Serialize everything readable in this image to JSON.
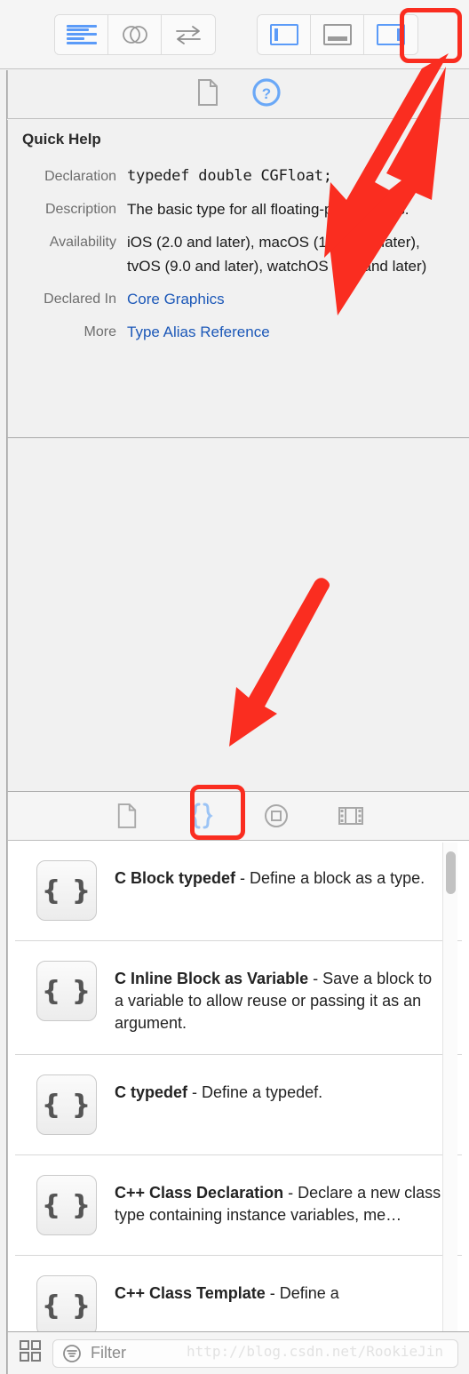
{
  "toolbar": {
    "editor_group": [
      {
        "name": "standard-editor",
        "icon": "lines-icon",
        "active": true
      },
      {
        "name": "assistant-editor",
        "icon": "venn-circles-icon",
        "active": false
      },
      {
        "name": "version-editor",
        "icon": "arrows-swap-icon",
        "active": false
      }
    ],
    "panel_group": [
      {
        "name": "navigator-toggle",
        "icon": "left-pane-icon",
        "active": true
      },
      {
        "name": "debug-area-toggle",
        "icon": "bottom-pane-icon",
        "active": false
      },
      {
        "name": "utilities-toggle",
        "icon": "right-pane-icon",
        "active": true,
        "highlighted": true
      }
    ]
  },
  "inspector_tabs": [
    {
      "name": "file-inspector",
      "icon": "document-icon",
      "selected": false
    },
    {
      "name": "quick-help-inspector",
      "icon": "question-circle-icon",
      "selected": true
    }
  ],
  "quick_help": {
    "title": "Quick Help",
    "rows": [
      {
        "label": "Declaration",
        "value": "typedef double CGFloat;",
        "mono": true,
        "link": false
      },
      {
        "label": "Description",
        "value": "The basic type for all floating-point values.",
        "mono": false,
        "link": false
      },
      {
        "label": "Availability",
        "value": "iOS (2.0 and later), macOS (10.5 and later), tvOS (9.0 and later), watchOS (2.0 and later)",
        "mono": false,
        "link": false
      },
      {
        "label": "Declared In",
        "value": "Core Graphics",
        "mono": false,
        "link": true
      },
      {
        "label": "More",
        "value": "Type Alias Reference",
        "mono": false,
        "link": true
      }
    ]
  },
  "library_tabs": [
    {
      "name": "file-template-library",
      "icon": "document-icon",
      "selected": false
    },
    {
      "name": "code-snippet-library",
      "icon": "braces-icon",
      "selected": true,
      "highlighted": true
    },
    {
      "name": "object-library",
      "icon": "circle-square-icon",
      "selected": false
    },
    {
      "name": "media-library",
      "icon": "film-strip-icon",
      "selected": false
    }
  ],
  "snippets": [
    {
      "icon": "{ }",
      "title": "C Block typedef",
      "desc": "Define a block as a type."
    },
    {
      "icon": "{ }",
      "title": "C Inline Block as Variable",
      "desc": "Save a block to a variable to allow reuse or passing it as an argument."
    },
    {
      "icon": "{ }",
      "title": "C typedef",
      "desc": "Define a typedef."
    },
    {
      "icon": "{ }",
      "title": "C++ Class Declaration",
      "desc": "Declare a new class type containing instance variables, me…"
    },
    {
      "icon": "{ }",
      "title": "C++ Class Template",
      "desc": "Define a"
    }
  ],
  "bottom_bar": {
    "grid_icon": "grid-view-icon",
    "filter_icon": "filter-icon",
    "filter_placeholder": "Filter",
    "watermark": "http://blog.csdn.net/RookieJin"
  },
  "colors": {
    "accent_blue": "#5b9bf8",
    "link_blue": "#1c58b8",
    "highlight_red": "#fa2d20",
    "panel_bg": "#f1f1f1"
  }
}
